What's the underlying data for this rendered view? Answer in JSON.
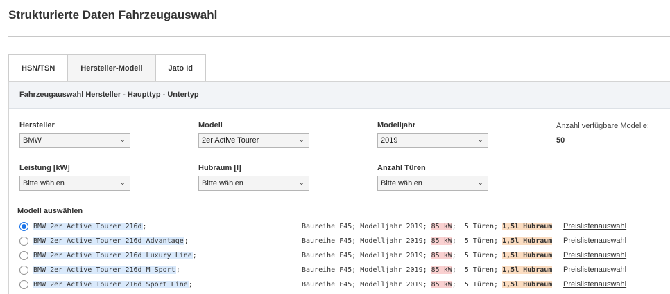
{
  "page_title": "Strukturierte Daten Fahrzeugauswahl",
  "tabs": [
    {
      "label": "HSN/TSN",
      "active": true
    },
    {
      "label": "Hersteller-Modell",
      "active": false
    },
    {
      "label": "Jato Id",
      "active": false
    }
  ],
  "panel_header": "Fahrzeugauswahl Hersteller - Haupttyp - Untertyp",
  "fields": {
    "hersteller": {
      "label": "Hersteller",
      "value": "BMW"
    },
    "modell": {
      "label": "Modell",
      "value": "2er Active Tourer"
    },
    "modelljahr": {
      "label": "Modelljahr",
      "value": "2019"
    },
    "leistung": {
      "label": "Leistung [kW]",
      "value": "Bitte wählen"
    },
    "hubraum": {
      "label": "Hubraum [l]",
      "value": "Bitte wählen"
    },
    "tueren": {
      "label": "Anzahl Türen",
      "value": "Bitte wählen"
    }
  },
  "available_models": {
    "label": "Anzahl verfügbare Modelle:",
    "count": "50"
  },
  "model_select_label": "Modell auswählen",
  "models": [
    {
      "name": "BMW 2er Active Tourer 216d",
      "baureihe": "Baureihe F45; Modelljahr 2019;",
      "kw": "85 kW",
      "tueren": "5 Türen;",
      "hubraum": "1,5l Hubraum",
      "link": "Preislistenauswahl",
      "selected": true
    },
    {
      "name": "BMW 2er Active Tourer 216d Advantage",
      "baureihe": "Baureihe F45; Modelljahr 2019;",
      "kw": "85 kW",
      "tueren": "5 Türen;",
      "hubraum": "1,5l Hubraum",
      "link": "Preislistenauswahl",
      "selected": false
    },
    {
      "name": "BMW 2er Active Tourer 216d Luxury Line",
      "baureihe": "Baureihe F45; Modelljahr 2019;",
      "kw": "85 kW",
      "tueren": "5 Türen;",
      "hubraum": "1,5l Hubraum",
      "link": "Preislistenauswahl",
      "selected": false
    },
    {
      "name": "BMW 2er Active Tourer 216d M Sport",
      "baureihe": "Baureihe F45; Modelljahr 2019;",
      "kw": "85 kW",
      "tueren": "5 Türen;",
      "hubraum": "1,5l Hubraum",
      "link": "Preislistenauswahl",
      "selected": false
    },
    {
      "name": "BMW 2er Active Tourer 216d Sport Line",
      "baureihe": "Baureihe F45; Modelljahr 2019;",
      "kw": "85 kW",
      "tueren": "5 Türen;",
      "hubraum": "1,5l Hubraum",
      "link": "Preislistenauswahl",
      "selected": false
    }
  ],
  "icons": {
    "dropdown": "chevron-down-icon"
  },
  "colors": {
    "radio_selected": "#1a73e8",
    "name_highlight": "#d9e9fb",
    "kw_highlight": "#f9d0d0",
    "hubraum_highlight": "#fbdcc0"
  }
}
